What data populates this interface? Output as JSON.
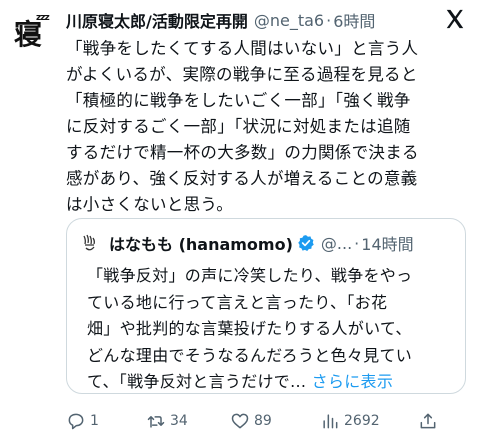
{
  "tweet": {
    "author_name": "川原寝太郎/活動限定再開",
    "handle": "@ne_ta6",
    "separator": "·",
    "time": "6時間",
    "text": "「戦争をしたくてする人間はいない」と言う人\nがよくいるが、実際の戦争に至る過程を見ると\n「積極的に戦争をしたいごく一部」「強く戦争\nに反対するごく一部」「状況に対処または追随\nするだけで精一杯の大多数」の力関係で決まる\n感があり、強く反対する人が増えることの意義\nは小さくないと思う。",
    "avatar_text": "寝",
    "avatar_zzz": "zzz"
  },
  "quote": {
    "author_name": "はなもも (hanamomo)",
    "handle": "@...",
    "separator": "·",
    "time": "14時間",
    "text": "「戦争反対」の声に冷笑したり、戦争をやっ\nている地に行って言えと言ったり、「お花\n畑」や批判的な言葉投げたりする人がいて、\nどんな理由でそうなるんだろうと色々見てい\nて、「戦争反対と言うだけで... ",
    "show_more": "さらに表示"
  },
  "actions": {
    "replies": "1",
    "retweets": "34",
    "likes": "89",
    "views": "2692"
  },
  "colors": {
    "text": "#0f1419",
    "muted": "#536471",
    "link": "#1d9bf0",
    "border": "#cfd9de",
    "verified": "#1d9bf0"
  },
  "icons": [
    "x-logo-icon",
    "verified-badge-icon",
    "reply-icon",
    "retweet-icon",
    "like-icon",
    "views-icon",
    "share-icon"
  ]
}
